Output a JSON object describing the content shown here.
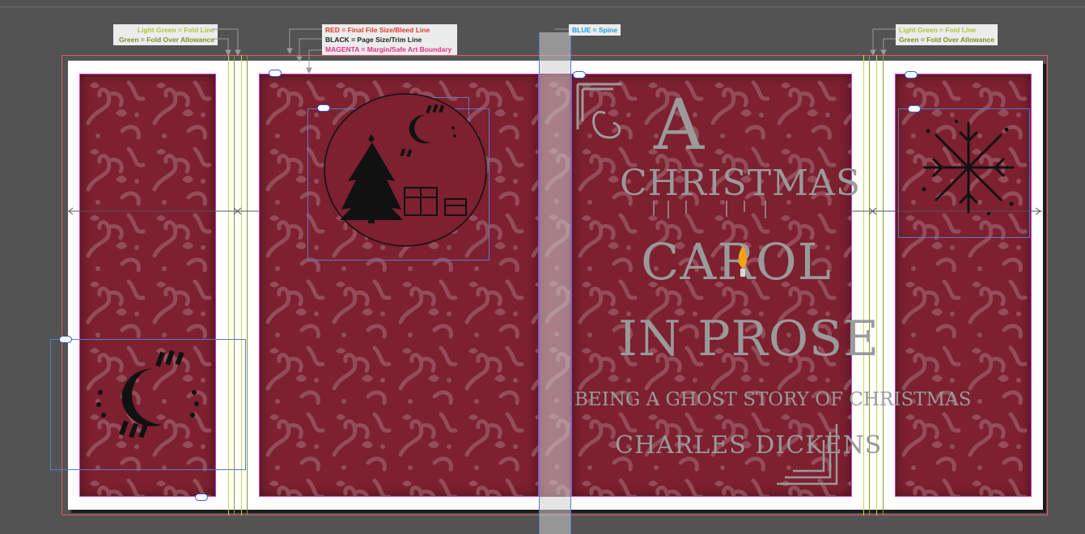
{
  "legend": {
    "left": {
      "line1": "Light Green = Fold Line",
      "line2": "Green = Fold Over Allowance"
    },
    "center": {
      "line1": "RED = Final File Size/Bleed Line",
      "line2": "BLACK = Page Size/Trim Line",
      "line3": "MAGENTA = Margin/Safe Art Boundary"
    },
    "spine": "BLUE = Spine",
    "right": {
      "line1": "Light Green = Fold Line",
      "line2": "Green = Fold Over Allowance"
    }
  },
  "cover": {
    "title_line1": "A",
    "title_line2": "CHRISTMAS",
    "title_line3": "CAROL",
    "title_line4": "IN PROSE",
    "subtitle": "BEING A GHOST STORY OF CHRISTMAS",
    "author": "CHARLES DICKENS"
  },
  "colors": {
    "panel": "#7d2030",
    "bleed_line": "#e05a6a",
    "safe_line": "#c83cd0",
    "spine_line": "#5a7ac8",
    "fold_line": "#c8d85a",
    "fold_allowance": "#8a9a32"
  }
}
